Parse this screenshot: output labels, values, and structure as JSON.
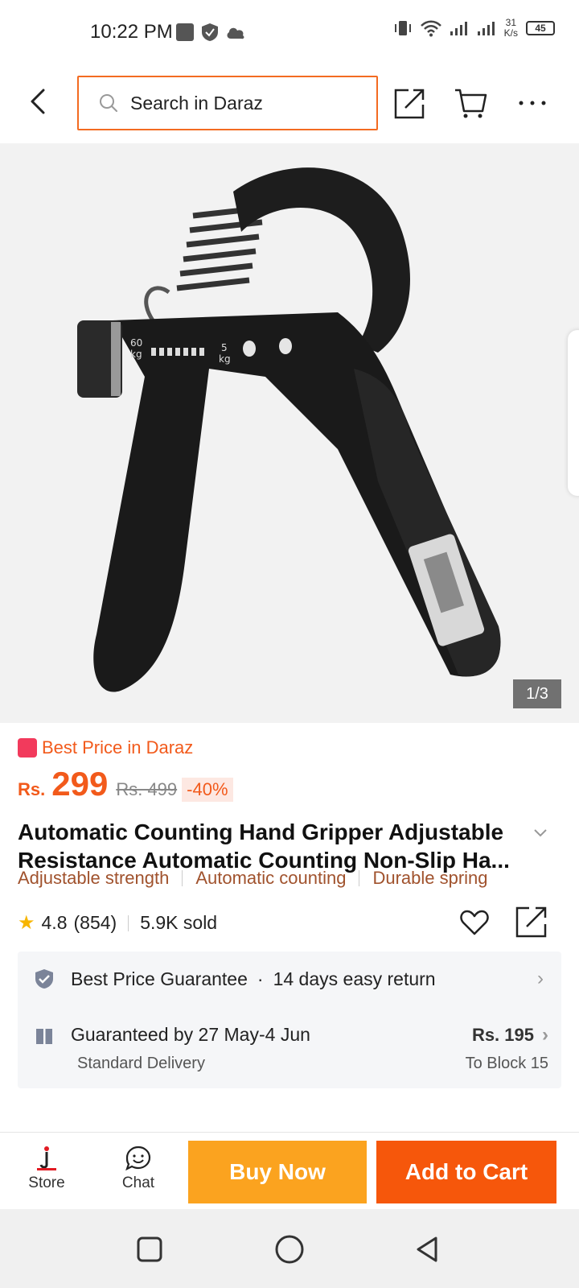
{
  "status_bar": {
    "time": "10:22 PM",
    "speed_value": "31",
    "speed_unit": "K/s",
    "battery": "45"
  },
  "header": {
    "search_placeholder": "Search in Daraz"
  },
  "gallery": {
    "counter": "1/3"
  },
  "product": {
    "best_price_label": "Best Price in Daraz",
    "currency": "Rs.",
    "price": "299",
    "old_price": "Rs. 499",
    "discount": "-40%",
    "title": "Automatic Counting Hand Gripper Adjustable Resistance Automatic Counting Non-Slip Ha...",
    "tags": [
      "Adjustable strength",
      "Automatic counting",
      "Durable spring"
    ],
    "rating": "4.8",
    "rating_count": "(854)",
    "sold": "5.9K sold"
  },
  "services": {
    "guarantee": "Best Price Guarantee",
    "return_policy": "14 days easy return",
    "delivery_date": "Guaranteed by 27 May-4 Jun",
    "delivery_type": "Standard Delivery",
    "delivery_fee": "Rs. 195",
    "delivery_location": "To Block 15"
  },
  "action_bar": {
    "store_label": "Store",
    "chat_label": "Chat",
    "buy_now": "Buy Now",
    "add_to_cart": "Add to Cart"
  },
  "colors": {
    "accent": "#f25a1b",
    "buy_now": "#fba31f",
    "add_to_cart": "#f6570b",
    "tag_text": "#a0522d"
  }
}
